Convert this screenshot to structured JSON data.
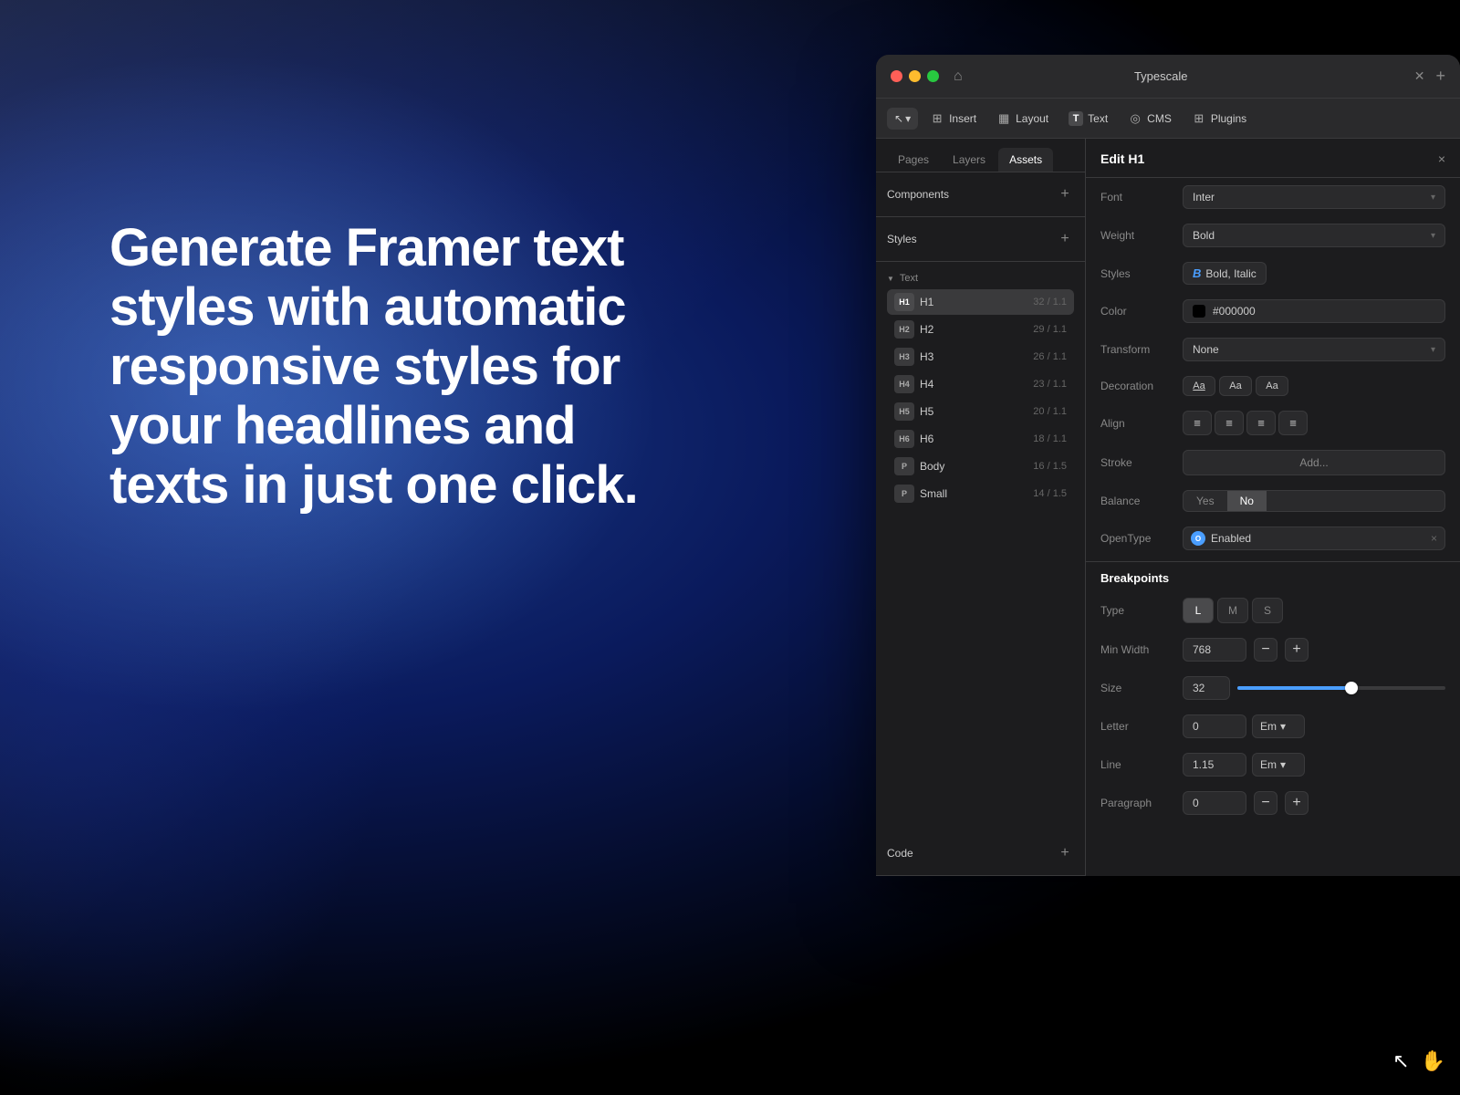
{
  "background": {
    "heroText": "Generate Framer text styles with automatic responsive styles for your headlines and texts in just one click."
  },
  "window": {
    "title": "Typescale",
    "trafficLights": [
      "red",
      "yellow",
      "green"
    ]
  },
  "toolbar": {
    "arrowLabel": "↖",
    "dropdownArrow": "▾",
    "insertLabel": "Insert",
    "layoutLabel": "Layout",
    "textLabel": "Text",
    "cmsLabel": "CMS",
    "pluginsLabel": "Plugins"
  },
  "leftPanel": {
    "tabs": [
      "Pages",
      "Layers",
      "Assets"
    ],
    "activeTab": "Assets",
    "components": {
      "label": "Components",
      "addIcon": "+"
    },
    "styles": {
      "label": "Styles",
      "addIcon": "+",
      "groupLabel": "Text",
      "items": [
        {
          "badge": "H1",
          "name": "H1",
          "size": "32 / 1.1",
          "active": true
        },
        {
          "badge": "H2",
          "name": "H2",
          "size": "29 / 1.1",
          "active": false
        },
        {
          "badge": "H3",
          "name": "H3",
          "size": "26 / 1.1",
          "active": false
        },
        {
          "badge": "H4",
          "name": "H4",
          "size": "23 / 1.1",
          "active": false
        },
        {
          "badge": "H5",
          "name": "H5",
          "size": "20 / 1.1",
          "active": false
        },
        {
          "badge": "H6",
          "name": "H6",
          "size": "18 / 1.1",
          "active": false
        },
        {
          "badge": "P",
          "name": "Body",
          "size": "16 / 1.5",
          "active": false
        },
        {
          "badge": "P",
          "name": "Small",
          "size": "14 / 1.5",
          "active": false
        }
      ]
    },
    "code": {
      "label": "Code",
      "addIcon": "+"
    }
  },
  "editPanel": {
    "title": "Edit H1",
    "closeIcon": "×",
    "font": {
      "label": "Font",
      "value": "Inter",
      "arrow": "▾"
    },
    "weight": {
      "label": "Weight",
      "value": "Bold",
      "arrow": "▾"
    },
    "styles": {
      "label": "Styles",
      "icon": "B",
      "value": "Bold, Italic"
    },
    "color": {
      "label": "Color",
      "swatch": "#000000",
      "value": "#000000"
    },
    "transform": {
      "label": "Transform",
      "value": "None",
      "arrow": "▾"
    },
    "decoration": {
      "label": "Decoration",
      "buttons": [
        "Aa",
        "Aa",
        "Aa"
      ]
    },
    "align": {
      "label": "Align",
      "icons": [
        "≡",
        "≡",
        "≡",
        "≡"
      ]
    },
    "stroke": {
      "label": "Stroke",
      "addLabel": "Add..."
    },
    "balance": {
      "label": "Balance",
      "options": [
        "Yes",
        "No"
      ],
      "active": "No"
    },
    "opentype": {
      "label": "OpenType",
      "dotLabel": "O",
      "value": "Enabled",
      "closeIcon": "×"
    },
    "breakpoints": {
      "sectionLabel": "Breakpoints",
      "type": {
        "label": "Type",
        "options": [
          "L",
          "M",
          "S"
        ],
        "active": "L"
      },
      "minWidth": {
        "label": "Min Width",
        "value": "768"
      },
      "size": {
        "label": "Size",
        "value": "32",
        "sliderPercent": 55
      },
      "letter": {
        "label": "Letter",
        "value": "0",
        "unit": "Em",
        "unitArrow": "▾"
      },
      "line": {
        "label": "Line",
        "value": "1.15",
        "unit": "Em",
        "unitArrow": "▾"
      },
      "paragraph": {
        "label": "Paragraph",
        "value": "0",
        "minusLabel": "−",
        "plusLabel": "+"
      }
    }
  }
}
